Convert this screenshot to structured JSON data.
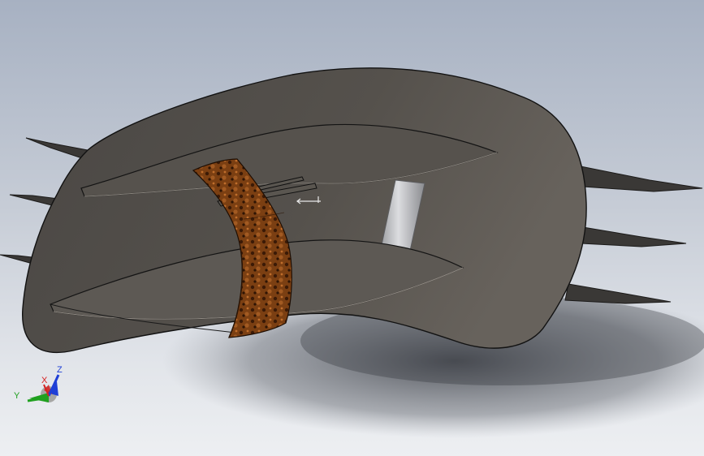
{
  "viewport": {
    "background_top": "#a7b1c2",
    "background_bottom": "#edeff2"
  },
  "model": {
    "body_color": "#4e4b47",
    "body_highlight": "#6a6560",
    "strap_color": "#7a3e12",
    "post_color": "#b9babd",
    "fin_color": "#3c3a38"
  },
  "triad": {
    "x_label": "X",
    "y_label": "Y",
    "z_label": "Z",
    "x_color": "#d62020",
    "y_color": "#1fa01f",
    "z_color": "#1f3fd6"
  }
}
